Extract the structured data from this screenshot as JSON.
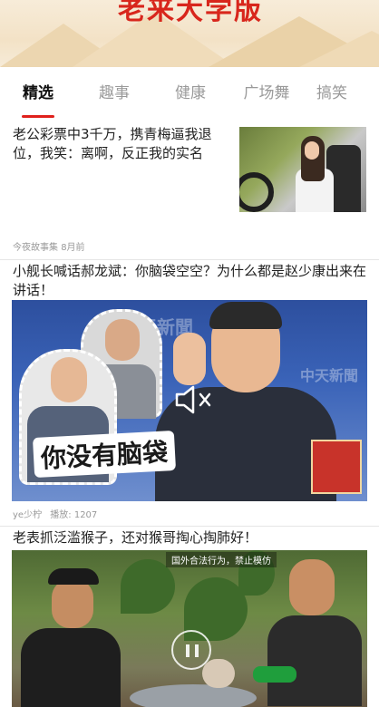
{
  "banner": {
    "title": "老来大学版"
  },
  "tabs": [
    {
      "label": "精选",
      "active": true
    },
    {
      "label": "趣事",
      "active": false
    },
    {
      "label": "健康",
      "active": false
    },
    {
      "label": "广场舞",
      "active": false
    },
    {
      "label": "搞笑",
      "active": false
    }
  ],
  "feed": [
    {
      "title": "老公彩票中3千万，携青梅逼我退位，我笑：离啊，反正我的实名",
      "source": "今夜故事集",
      "time": "8月前"
    },
    {
      "title": "小舰长喊话郝龙斌：你脑袋空空？为什么都是赵少康出来在讲话！",
      "caption": "你没有脑袋",
      "watermark": "中天新聞",
      "author": "ye少柠",
      "plays_label": "播放:",
      "plays": "1207"
    },
    {
      "title": "老表抓泛滥猴子，还对猴哥掏心掏肺好！",
      "notice": "国外合法行为，禁止模仿"
    }
  ],
  "colors": {
    "accent": "#e0201c",
    "tab_inactive": "#9a9a9a",
    "meta": "#999999"
  },
  "icons": {
    "mute": "speaker-muted-icon",
    "pause": "pause-icon"
  }
}
